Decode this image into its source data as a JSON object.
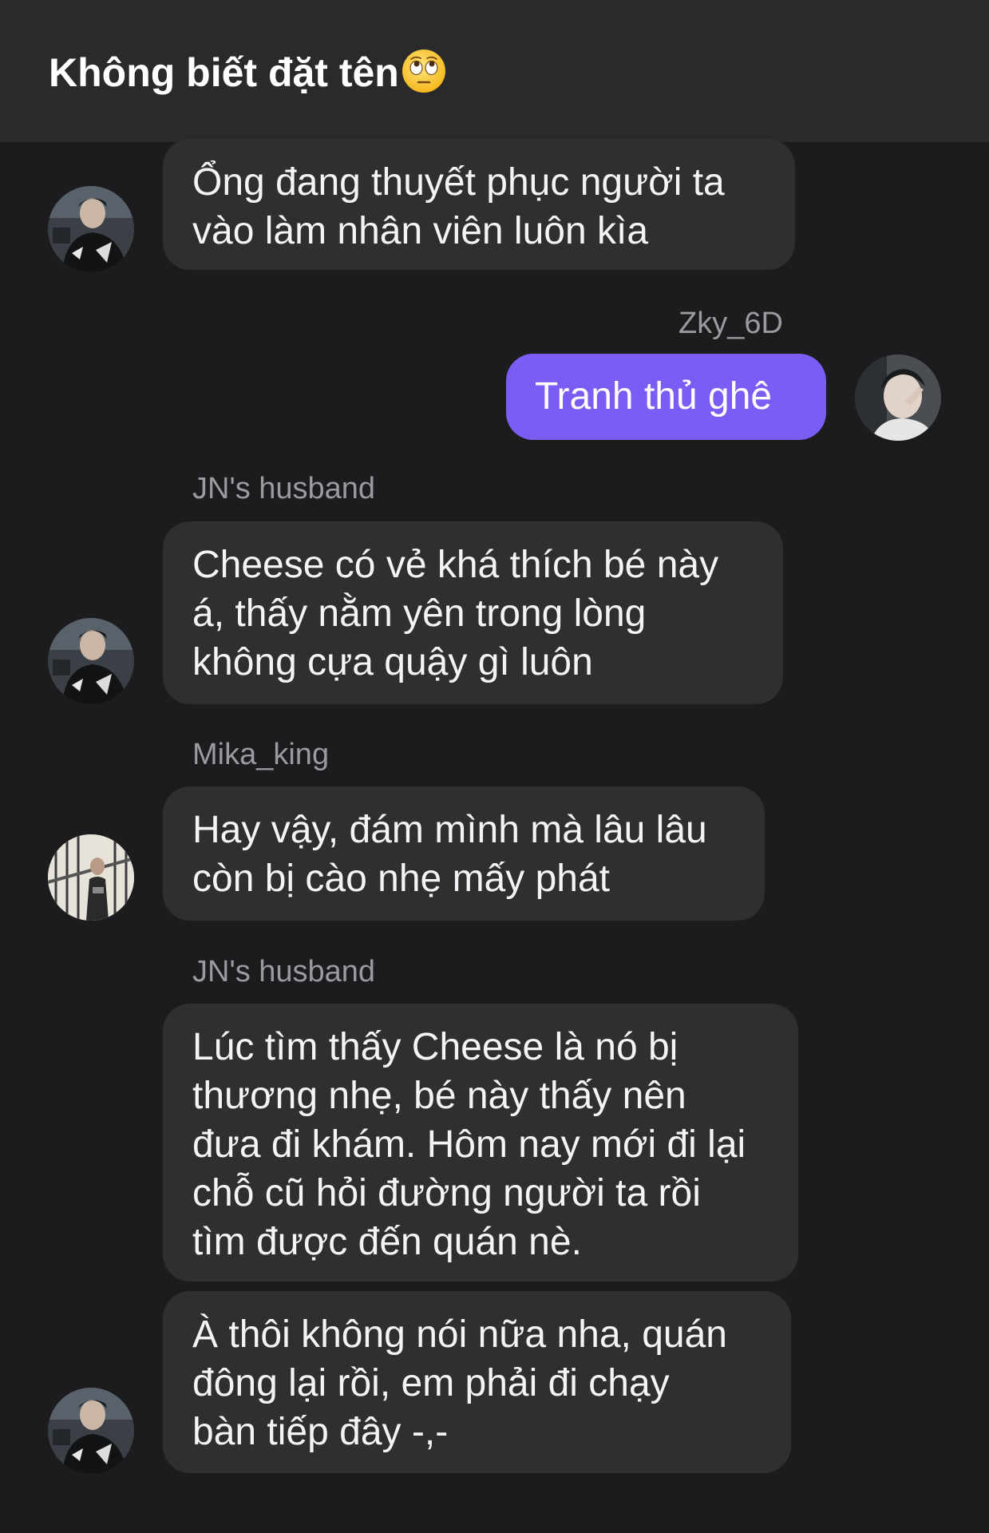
{
  "header": {
    "title": "Không biết đặt tên",
    "emoji": "face-with-rolling-eyes-emoji"
  },
  "messages": [
    {
      "sender": "",
      "mine": false,
      "avatar": "user-jn-avatar",
      "lines": [
        "Ổng đang thuyết phục người ta",
        "vào làm nhân viên luôn kìa"
      ]
    },
    {
      "sender": "Zky_6D",
      "mine": true,
      "avatar": "user-zky-avatar",
      "lines": [
        "Tranh thủ ghê"
      ]
    },
    {
      "sender": "JN's husband",
      "mine": false,
      "avatar": "user-jn-avatar",
      "lines": [
        "Cheese có vẻ khá thích bé này",
        "á, thấy nằm yên trong lòng",
        "không cựa quậy gì luôn"
      ]
    },
    {
      "sender": "Mika_king",
      "mine": false,
      "avatar": "user-mika-avatar",
      "lines": [
        "Hay vậy, đám mình mà lâu lâu",
        "còn bị cào nhẹ mấy phát"
      ]
    },
    {
      "sender": "JN's husband",
      "mine": false,
      "avatar": "",
      "lines": [
        "Lúc tìm thấy Cheese là nó bị",
        "thương nhẹ, bé này thấy nên",
        "đưa đi khám. Hôm nay mới đi lại",
        "chỗ cũ hỏi đường người ta rồi",
        "tìm được đến quán nè."
      ]
    },
    {
      "sender": "",
      "mine": false,
      "avatar": "user-jn-avatar",
      "lines": [
        "À thôi không nói nữa nha, quán",
        "đông lại rồi, em phải đi chạy",
        "bàn tiếp đây -,-"
      ]
    }
  ],
  "colors": {
    "background": "#1c1c1e",
    "header": "#2a2a2c",
    "bubble_other": "#2f2f32",
    "bubble_mine": "#7b5cf4",
    "sender_name": "#9a9a9f"
  }
}
